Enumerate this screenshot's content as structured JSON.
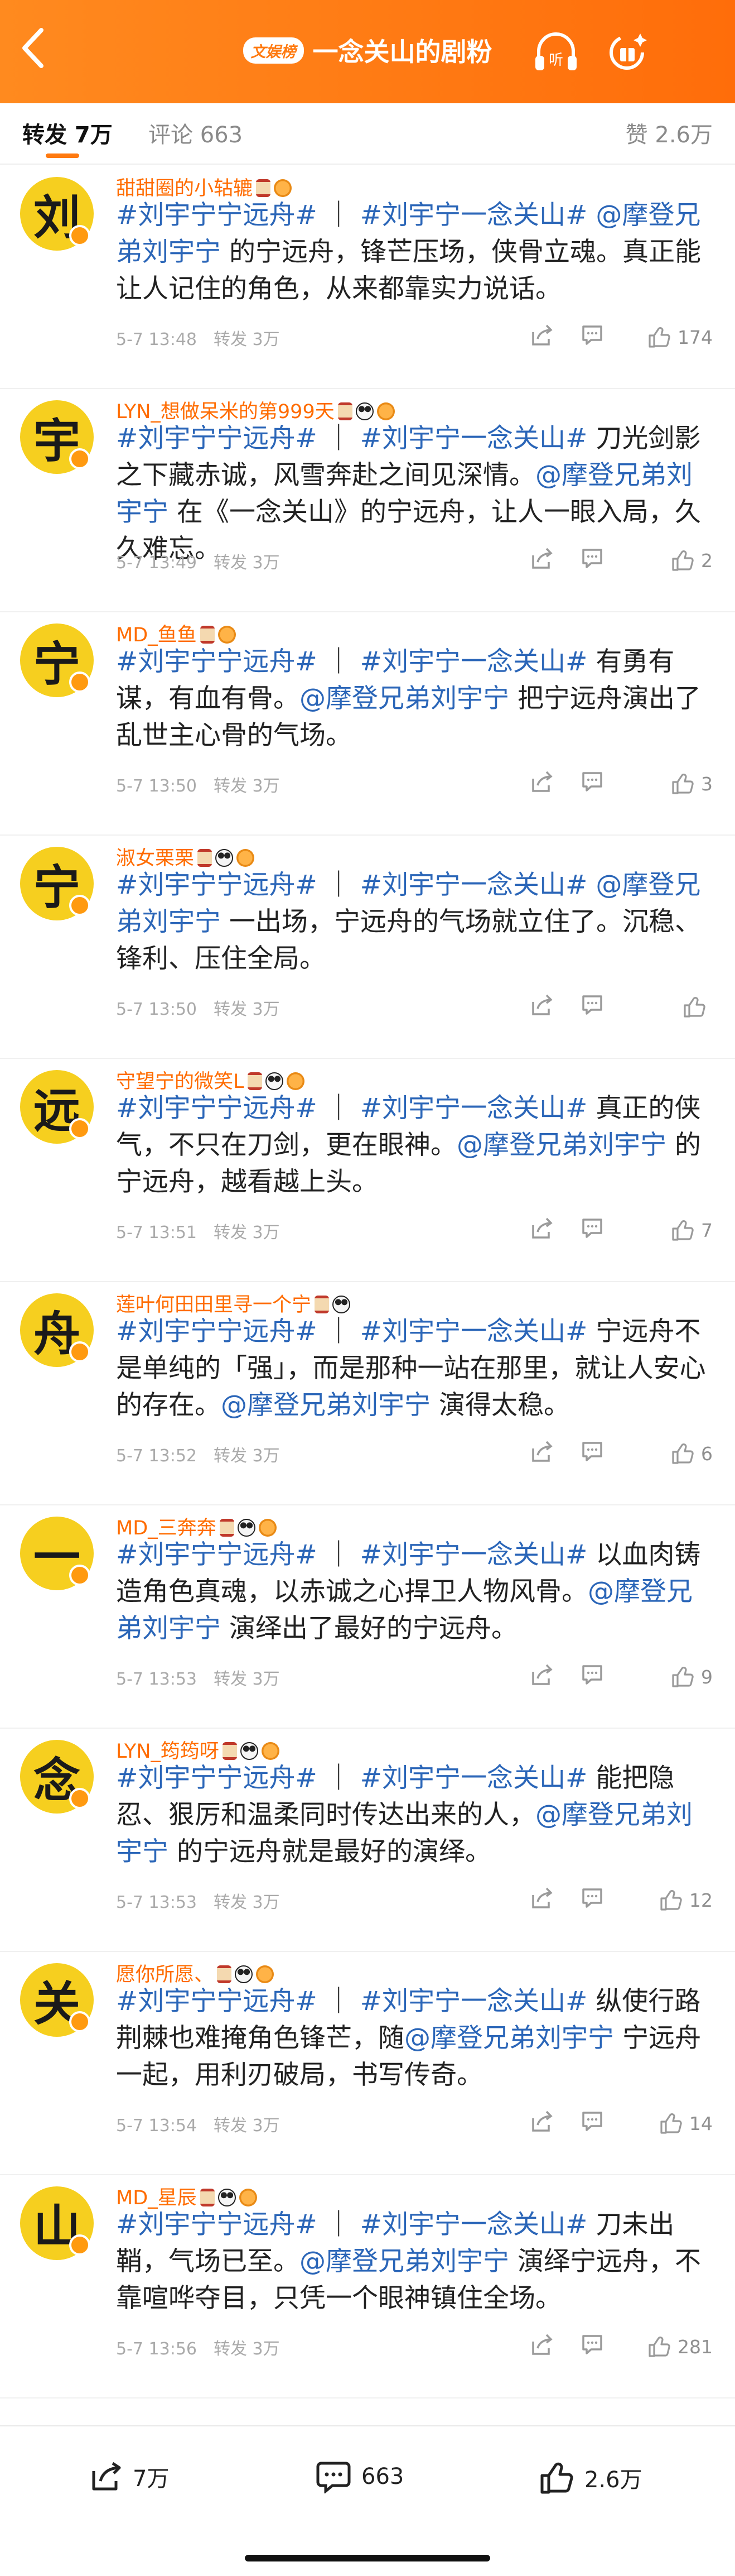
{
  "header": {
    "badge": "文娱榜",
    "title": "一念关山的剧粉",
    "icons": [
      "back-arrow-icon",
      "headphones-listen-icon",
      "share-gift-icon"
    ],
    "listen_label": "听",
    "accent_color": "#ff7a10"
  },
  "tabs": {
    "repost": "转发 7万",
    "comment": "评论 663",
    "likes": "赞 2.6万"
  },
  "comments": [
    {
      "avatar_char": "刘",
      "username": "甜甜圈的小轱辘",
      "badges": [
        "hourglass",
        "bun"
      ],
      "text": [
        {
          "t": "#刘宇宁宁远舟#",
          "k": "tag"
        },
        {
          "t": " ｜ ",
          "k": "plain"
        },
        {
          "t": "#刘宇宁一念关山#",
          "k": "tag"
        },
        {
          "t": " ",
          "k": "plain"
        },
        {
          "t": "@摩登兄弟刘宇宁",
          "k": "at"
        },
        {
          "t": " 的宁远舟，锋芒压场，侠骨立魂。真正能让人记住的角色，从来都靠实力说话。",
          "k": "plain"
        }
      ],
      "time": "5-7 13:48",
      "repost": "转发 3万",
      "likes": "174"
    },
    {
      "avatar_char": "宇",
      "username": "LYN_想做呆米的第999天",
      "badges": [
        "hourglass",
        "panda",
        "bun"
      ],
      "text": [
        {
          "t": "#刘宇宁宁远舟#",
          "k": "tag"
        },
        {
          "t": " ｜ ",
          "k": "plain"
        },
        {
          "t": "#刘宇宁一念关山#",
          "k": "tag"
        },
        {
          "t": " 刀光剑影之下藏赤诚，风雪奔赴之间见深情。",
          "k": "plain"
        },
        {
          "t": "@摩登兄弟刘宇宁",
          "k": "at"
        },
        {
          "t": " 在《一念关山》的宁远舟，让人一眼入局，久久难忘。",
          "k": "plain"
        }
      ],
      "time": "5-7 13:49",
      "repost": "转发 3万",
      "likes": "2"
    },
    {
      "avatar_char": "宁",
      "username": "MD_鱼鱼",
      "badges": [
        "hourglass",
        "bun"
      ],
      "text": [
        {
          "t": "#刘宇宁宁远舟#",
          "k": "tag"
        },
        {
          "t": " ｜ ",
          "k": "plain"
        },
        {
          "t": "#刘宇宁一念关山#",
          "k": "tag"
        },
        {
          "t": " 有勇有谋，有血有骨。",
          "k": "plain"
        },
        {
          "t": "@摩登兄弟刘宇宁",
          "k": "at"
        },
        {
          "t": " 把宁远舟演出了乱世主心骨的气场。",
          "k": "plain"
        }
      ],
      "time": "5-7 13:50",
      "repost": "转发 3万",
      "likes": "3"
    },
    {
      "avatar_char": "宁",
      "username": "淑女栗栗",
      "badges": [
        "hourglass",
        "panda",
        "bun"
      ],
      "text": [
        {
          "t": "#刘宇宁宁远舟#",
          "k": "tag"
        },
        {
          "t": " ｜ ",
          "k": "plain"
        },
        {
          "t": "#刘宇宁一念关山#",
          "k": "tag"
        },
        {
          "t": " ",
          "k": "plain"
        },
        {
          "t": "@摩登兄弟刘宇宁",
          "k": "at"
        },
        {
          "t": " 一出场，宁远舟的气场就立住了。沉稳、锋利、压住全局。",
          "k": "plain"
        }
      ],
      "time": "5-7 13:50",
      "repost": "转发 3万",
      "likes": ""
    },
    {
      "avatar_char": "远",
      "username": "守望宁的微笑L",
      "badges": [
        "hourglass",
        "panda",
        "bun"
      ],
      "text": [
        {
          "t": "#刘宇宁宁远舟#",
          "k": "tag"
        },
        {
          "t": " ｜ ",
          "k": "plain"
        },
        {
          "t": "#刘宇宁一念关山#",
          "k": "tag"
        },
        {
          "t": " 真正的侠气，不只在刀剑，更在眼神。",
          "k": "plain"
        },
        {
          "t": "@摩登兄弟刘宇宁",
          "k": "at"
        },
        {
          "t": " 的宁远舟，越看越上头。",
          "k": "plain"
        }
      ],
      "time": "5-7 13:51",
      "repost": "转发 3万",
      "likes": "7"
    },
    {
      "avatar_char": "舟",
      "username": "莲叶何田田里寻一个宁",
      "badges": [
        "hourglass",
        "panda"
      ],
      "text": [
        {
          "t": "#刘宇宁宁远舟#",
          "k": "tag"
        },
        {
          "t": " ｜ ",
          "k": "plain"
        },
        {
          "t": "#刘宇宁一念关山#",
          "k": "tag"
        },
        {
          "t": " 宁远舟不是单纯的「强」，而是那种一站在那里，就让人安心的存在。",
          "k": "plain"
        },
        {
          "t": "@摩登兄弟刘宇宁",
          "k": "at"
        },
        {
          "t": " 演得太稳。",
          "k": "plain"
        }
      ],
      "time": "5-7 13:52",
      "repost": "转发 3万",
      "likes": "6"
    },
    {
      "avatar_char": "一",
      "username": "MD_三奔奔",
      "badges": [
        "hourglass",
        "panda",
        "bun"
      ],
      "text": [
        {
          "t": "#刘宇宁宁远舟#",
          "k": "tag"
        },
        {
          "t": " ｜ ",
          "k": "plain"
        },
        {
          "t": "#刘宇宁一念关山#",
          "k": "tag"
        },
        {
          "t": " 以血肉铸造角色真魂，以赤诚之心捍卫人物风骨。",
          "k": "plain"
        },
        {
          "t": "@摩登兄弟刘宇宁",
          "k": "at"
        },
        {
          "t": " 演绎出了最好的宁远舟。",
          "k": "plain"
        }
      ],
      "time": "5-7 13:53",
      "repost": "转发 3万",
      "likes": "9"
    },
    {
      "avatar_char": "念",
      "username": "LYN_筠筠呀",
      "badges": [
        "hourglass",
        "panda",
        "bun"
      ],
      "text": [
        {
          "t": "#刘宇宁宁远舟#",
          "k": "tag"
        },
        {
          "t": " ｜ ",
          "k": "plain"
        },
        {
          "t": "#刘宇宁一念关山#",
          "k": "tag"
        },
        {
          "t": " 能把隐忍、狠厉和温柔同时传达出来的人，",
          "k": "plain"
        },
        {
          "t": "@摩登兄弟刘宇宁",
          "k": "at"
        },
        {
          "t": " 的宁远舟就是最好的演绎。",
          "k": "plain"
        }
      ],
      "time": "5-7 13:53",
      "repost": "转发 3万",
      "likes": "12"
    },
    {
      "avatar_char": "关",
      "username": "愿你所愿、",
      "badges": [
        "hourglass",
        "panda",
        "bun"
      ],
      "text": [
        {
          "t": "#刘宇宁宁远舟#",
          "k": "tag"
        },
        {
          "t": " ｜ ",
          "k": "plain"
        },
        {
          "t": "#刘宇宁一念关山#",
          "k": "tag"
        },
        {
          "t": " 纵使行路荆棘也难掩角色锋芒，随",
          "k": "plain"
        },
        {
          "t": "@摩登兄弟刘宇宁",
          "k": "at"
        },
        {
          "t": " 宁远舟一起，用利刃破局，书写传奇。",
          "k": "plain"
        }
      ],
      "time": "5-7 13:54",
      "repost": "转发 3万",
      "likes": "14"
    },
    {
      "avatar_char": "山",
      "username": "MD_星辰",
      "badges": [
        "hourglass",
        "panda",
        "bun"
      ],
      "text": [
        {
          "t": "#刘宇宁宁远舟#",
          "k": "tag"
        },
        {
          "t": " ｜ ",
          "k": "plain"
        },
        {
          "t": "#刘宇宁一念关山#",
          "k": "tag"
        },
        {
          "t": " 刀未出鞘，气场已至。",
          "k": "plain"
        },
        {
          "t": "@摩登兄弟刘宇宁",
          "k": "at"
        },
        {
          "t": " 演绎宁远舟，不靠喧哗夺目，只凭一个眼神镇住全场。",
          "k": "plain"
        }
      ],
      "time": "5-7 13:56",
      "repost": "转发 3万",
      "likes": "281"
    }
  ],
  "bottom_bar": {
    "repost_count": "7万",
    "comment_count": "663",
    "like_count": "2.6万"
  }
}
